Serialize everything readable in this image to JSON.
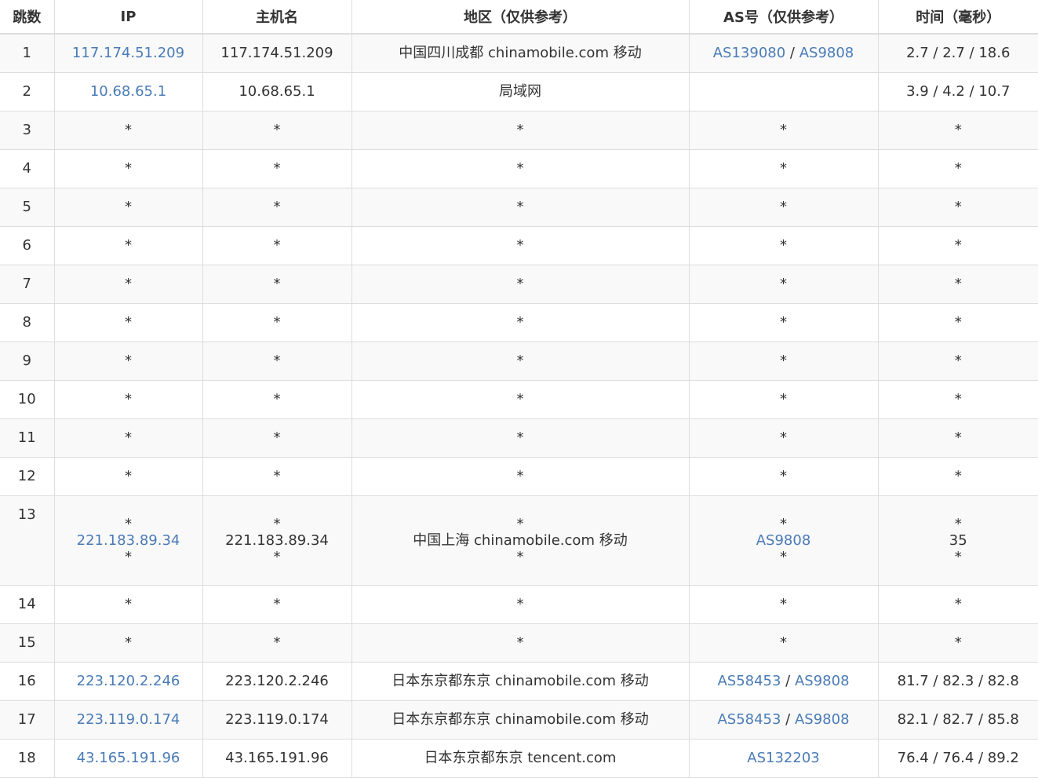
{
  "headers": [
    "跳数",
    "IP",
    "主机名",
    "地区（仅供参考）",
    "AS号（仅供参考）",
    "时间（毫秒）"
  ],
  "rows": [
    {
      "hop": "1",
      "ip": "117.174.51.209",
      "host": "117.174.51.209",
      "region": "中国四川成都 chinamobile.com 移动",
      "as": [
        "AS139080",
        "AS9808"
      ],
      "time": "2.7 / 2.7 / 18.6"
    },
    {
      "hop": "2",
      "ip": "10.68.65.1",
      "host": "10.68.65.1",
      "region": "局域网",
      "as": [],
      "time": "3.9 / 4.2 / 10.7"
    },
    {
      "hop": "3",
      "star": "*"
    },
    {
      "hop": "4",
      "star": "*"
    },
    {
      "hop": "5",
      "star": "*"
    },
    {
      "hop": "6",
      "star": "*"
    },
    {
      "hop": "7",
      "star": "*"
    },
    {
      "hop": "8",
      "star": "*"
    },
    {
      "hop": "9",
      "star": "*"
    },
    {
      "hop": "10",
      "star": "*"
    },
    {
      "hop": "11",
      "star": "*"
    },
    {
      "hop": "12",
      "star": "*"
    },
    {
      "hop": "13",
      "multi": true,
      "ip": "221.183.89.34",
      "host": "221.183.89.34",
      "region": "中国上海 chinamobile.com 移动",
      "as": [
        "AS9808"
      ],
      "time": "35",
      "star": "*"
    },
    {
      "hop": "14",
      "star": "*"
    },
    {
      "hop": "15",
      "star": "*"
    },
    {
      "hop": "16",
      "ip": "223.120.2.246",
      "host": "223.120.2.246",
      "region": "日本东京都东京 chinamobile.com 移动",
      "as": [
        "AS58453",
        "AS9808"
      ],
      "time": "81.7 / 82.3 / 82.8"
    },
    {
      "hop": "17",
      "ip": "223.119.0.174",
      "host": "223.119.0.174",
      "region": "日本东京都东京 chinamobile.com 移动",
      "as": [
        "AS58453",
        "AS9808"
      ],
      "time": "82.1 / 82.7 / 85.8"
    },
    {
      "hop": "18",
      "ip": "43.165.191.96",
      "host": "43.165.191.96",
      "region": "日本东京都东京 tencent.com",
      "as": [
        "AS132203"
      ],
      "time": "76.4 / 76.4 / 89.2"
    }
  ],
  "as_separator": " / ",
  "colors": {
    "link": "#4a7bb7",
    "text": "#333333",
    "stripe": "#f9f9f9",
    "border": "#dddddd"
  }
}
